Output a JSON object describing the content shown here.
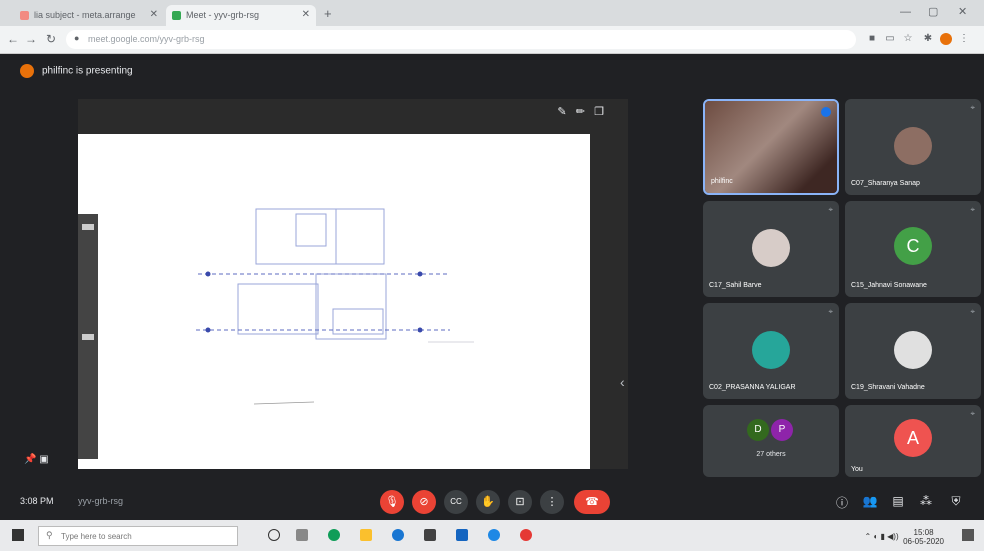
{
  "browser": {
    "tabs": [
      {
        "label": "lia subject - meta.arrange",
        "active": false
      },
      {
        "label": "Meet - yyv-grb-rsg",
        "active": true
      }
    ],
    "url": "meet.google.com/yyv-grb-rsg"
  },
  "meet": {
    "presenting_text": "philfinc is presenting",
    "time": "3:08 PM",
    "code": "yyv-grb-rsg",
    "participants": [
      {
        "name": "philfinc",
        "type": "video"
      },
      {
        "name": "C07_Sharanya Sanap",
        "type": "photo",
        "color": "#8d6e63"
      },
      {
        "name": "C17_Sahil Barve",
        "type": "photo",
        "color": "#d7ccc8"
      },
      {
        "name": "C15_Jahnavi Sonawane",
        "type": "letter",
        "letter": "C",
        "color": "#43a047"
      },
      {
        "name": "C02_PRASANNA YALIGAR",
        "type": "photo",
        "color": "#26a69a"
      },
      {
        "name": "C19_Shravani Vahadne",
        "type": "photo",
        "color": "#e0e0e0"
      },
      {
        "name": "27 others",
        "type": "others",
        "letters": [
          "D",
          "P"
        ],
        "colors": [
          "#33691e",
          "#8e24aa"
        ]
      },
      {
        "name": "You",
        "type": "letter",
        "letter": "A",
        "color": "#ef5350"
      }
    ],
    "controls": {
      "mic": "mic-off",
      "cam": "cam-off",
      "cc": "CC",
      "hand": "hand",
      "present": "present",
      "more": "⋮",
      "end": "end-call"
    }
  },
  "taskbar": {
    "search_placeholder": "Type here to search",
    "clock_time": "15:08",
    "clock_date": "06-05-2020"
  },
  "colors": {
    "meet_bg": "#202124",
    "tile_bg": "#3c4043",
    "red": "#ea4335"
  }
}
